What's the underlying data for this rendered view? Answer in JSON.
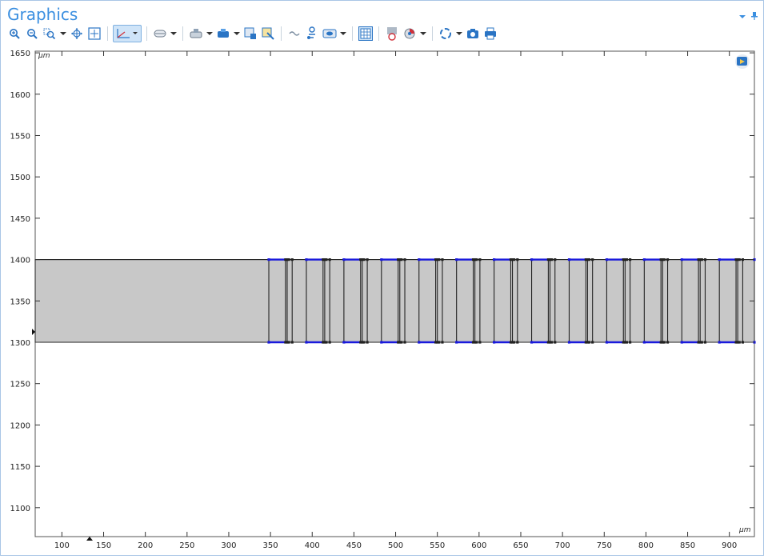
{
  "window": {
    "title": "Graphics"
  },
  "toolbar": {
    "items": [
      {
        "name": "zoom-in-icon"
      },
      {
        "name": "zoom-out-icon"
      },
      {
        "name": "zoom-box-icon"
      },
      {
        "name": "zoom-extents-icon"
      },
      {
        "name": "move-icon"
      },
      {
        "name": "axis-orientation-icon"
      },
      {
        "name": "plane-icon"
      },
      {
        "name": "select-icon"
      },
      {
        "name": "render-icon"
      },
      {
        "name": "clip-icon"
      },
      {
        "name": "selection-color-icon"
      },
      {
        "name": "transparency-icon"
      },
      {
        "name": "view-icon"
      },
      {
        "name": "grid-icon"
      },
      {
        "name": "lighting-icon"
      },
      {
        "name": "scene-icon"
      },
      {
        "name": "reset-icon"
      },
      {
        "name": "camera-icon"
      },
      {
        "name": "print-icon"
      }
    ]
  },
  "plot": {
    "unit_y": "µm",
    "unit_x": "µm",
    "y_ticks": [
      "1650",
      "1600",
      "1550",
      "1500",
      "1450",
      "1400",
      "1350",
      "1300",
      "1250",
      "1200",
      "1150",
      "1100"
    ],
    "x_ticks": [
      "100",
      "150",
      "200",
      "250",
      "300",
      "350",
      "400",
      "450",
      "500",
      "550",
      "600",
      "650",
      "700",
      "750",
      "800",
      "850",
      "900"
    ],
    "geometry": {
      "rect_y_range": [
        1300,
        1400
      ],
      "rect_x_start": 50,
      "x_range": [
        68,
        930
      ],
      "y_range": [
        1065,
        1652
      ],
      "segments_start": 350,
      "segment_period": 45,
      "segment_count": 13,
      "colors": {
        "fill": "#c8c8c8",
        "edge": "#222222",
        "highlight": "#1a1adc"
      }
    }
  }
}
